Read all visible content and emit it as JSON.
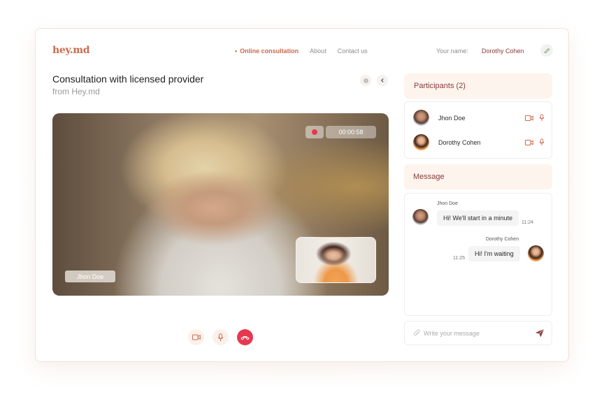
{
  "app": {
    "logo": "hey.md",
    "nav": [
      {
        "label": "Online consultation",
        "active": true
      },
      {
        "label": "About",
        "active": false
      },
      {
        "label": "Contact us",
        "active": false
      }
    ],
    "your_name_label": "Your name:",
    "your_name_value": "Dorothy Cohen"
  },
  "consultation": {
    "title": "Consultation with licensed provider",
    "subtitle": "from Hey.md"
  },
  "video": {
    "timer": "00:00:58",
    "speaker_name": "Jhon Doe",
    "recording": true
  },
  "participants": {
    "header": "Participants (2)",
    "list": [
      {
        "name": "Jhon Doe"
      },
      {
        "name": "Dorothy Cohen"
      }
    ]
  },
  "messages": {
    "header": "Message",
    "items": [
      {
        "sender": "Jhon Doe",
        "text": "Hi! We'll start in a minute",
        "time": "11:24"
      },
      {
        "sender": "Dorothy Cohen",
        "text": "Hi! I'm waiting",
        "time": "11:25"
      }
    ],
    "input_placeholder": "Write your message"
  },
  "colors": {
    "accent": "#c96b4e",
    "name_color": "#8b3a3a",
    "end_call": "#e63950",
    "panel_bg": "#fdf4ee"
  },
  "icons": [
    "pencil-icon",
    "gear-icon",
    "chevron-left-icon",
    "video-camera-icon",
    "microphone-icon",
    "phone-hangup-icon",
    "paperclip-icon",
    "send-icon"
  ]
}
